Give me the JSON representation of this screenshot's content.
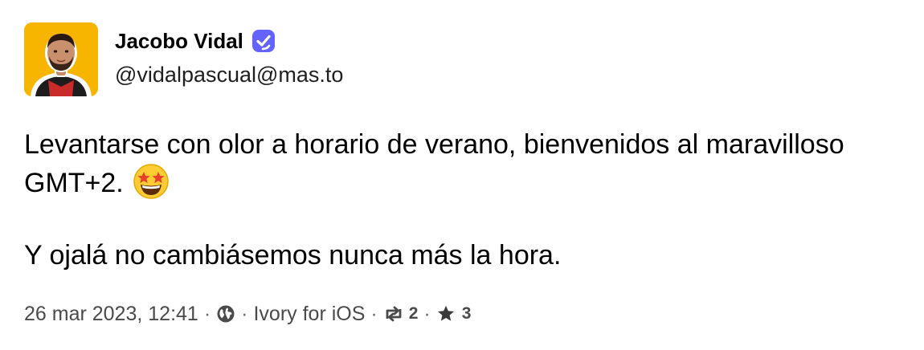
{
  "author": {
    "display_name": "Jacobo Vidal",
    "handle": "@vidalpascual@mas.to",
    "avatar_icon": "profile-photo",
    "verified_icon": "verified-badge-icon",
    "verified_color": "#6364ff",
    "avatar_bg_color": "#f7b500"
  },
  "post": {
    "line1": "Levantarse con olor a horario de verano, bienvenidos al maravilloso GMT+2.",
    "emoji": "star-struck-emoji",
    "line2": "Y ojalá no cambiásemos nunca más la hora."
  },
  "meta": {
    "date": "26 mar 2023, 12:41",
    "separator": "·",
    "visibility_icon": "globe-icon",
    "client": "Ivory for iOS",
    "boost_icon": "boost-icon",
    "boost_count": "2",
    "favourite_icon": "star-icon",
    "favourite_count": "3"
  }
}
